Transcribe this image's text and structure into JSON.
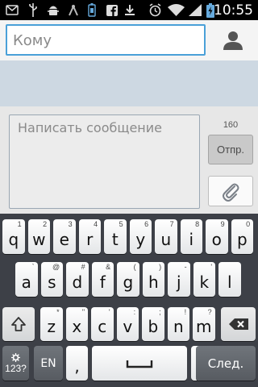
{
  "status_bar": {
    "time": "10:55",
    "icons": [
      "sms-icon",
      "usb-icon",
      "android-debug-icon",
      "android-icon",
      "battery-saver-icon",
      "facebook-icon",
      "download-icon",
      "alarm-icon",
      "wifi-icon",
      "signal-icon",
      "battery-charging-icon"
    ]
  },
  "recipient": {
    "placeholder": "Кому",
    "contact_icon": "person-icon"
  },
  "compose": {
    "placeholder": "Написать сообщение",
    "char_count": "160",
    "send_label": "Отпр.",
    "attach_icon": "paperclip-icon"
  },
  "keyboard": {
    "row1": [
      {
        "ch": "q",
        "sec": "1"
      },
      {
        "ch": "w",
        "sec": "2"
      },
      {
        "ch": "e",
        "sec": "3"
      },
      {
        "ch": "r",
        "sec": "4"
      },
      {
        "ch": "t",
        "sec": "5"
      },
      {
        "ch": "y",
        "sec": "6"
      },
      {
        "ch": "u",
        "sec": "7"
      },
      {
        "ch": "i",
        "sec": "8"
      },
      {
        "ch": "o",
        "sec": "9"
      },
      {
        "ch": "p",
        "sec": "0"
      }
    ],
    "row2": [
      {
        "ch": "a",
        "sec": "`"
      },
      {
        "ch": "s",
        "sec": "@"
      },
      {
        "ch": "d",
        "sec": "#"
      },
      {
        "ch": "f",
        "sec": "&"
      },
      {
        "ch": "g",
        "sec": "("
      },
      {
        "ch": "h",
        "sec": ")"
      },
      {
        "ch": "j",
        "sec": "-"
      },
      {
        "ch": "k",
        "sec": "'"
      },
      {
        "ch": "l",
        "sec": ""
      }
    ],
    "row3": [
      {
        "ch": "z",
        "sec": "*"
      },
      {
        "ch": "x",
        "sec": "\""
      },
      {
        "ch": "c",
        "sec": "'"
      },
      {
        "ch": "v",
        "sec": ":"
      },
      {
        "ch": "b",
        "sec": ";"
      },
      {
        "ch": "n",
        "sec": "!"
      },
      {
        "ch": "m",
        "sec": "?"
      }
    ],
    "shift_icon": "shift-icon",
    "backspace_icon": "backspace-icon",
    "symbols_label": "123?",
    "settings_icon": "gear-icon",
    "language_label": "EN",
    "comma_label": ",",
    "space_icon": "space-icon",
    "period_label": ".",
    "next_label": "След."
  }
}
